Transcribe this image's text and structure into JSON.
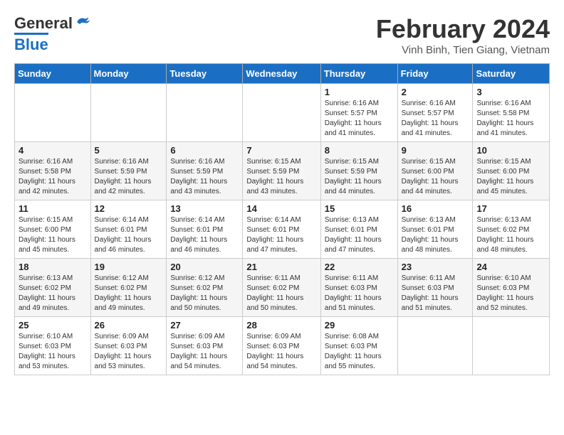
{
  "header": {
    "logo": {
      "line1": "General",
      "line2": "Blue"
    },
    "title": "February 2024",
    "location": "Vinh Binh, Tien Giang, Vietnam"
  },
  "calendar": {
    "days_of_week": [
      "Sunday",
      "Monday",
      "Tuesday",
      "Wednesday",
      "Thursday",
      "Friday",
      "Saturday"
    ],
    "weeks": [
      [
        {
          "day": "",
          "info": ""
        },
        {
          "day": "",
          "info": ""
        },
        {
          "day": "",
          "info": ""
        },
        {
          "day": "",
          "info": ""
        },
        {
          "day": "1",
          "info": "Sunrise: 6:16 AM\nSunset: 5:57 PM\nDaylight: 11 hours and 41 minutes."
        },
        {
          "day": "2",
          "info": "Sunrise: 6:16 AM\nSunset: 5:57 PM\nDaylight: 11 hours and 41 minutes."
        },
        {
          "day": "3",
          "info": "Sunrise: 6:16 AM\nSunset: 5:58 PM\nDaylight: 11 hours and 41 minutes."
        }
      ],
      [
        {
          "day": "4",
          "info": "Sunrise: 6:16 AM\nSunset: 5:58 PM\nDaylight: 11 hours and 42 minutes."
        },
        {
          "day": "5",
          "info": "Sunrise: 6:16 AM\nSunset: 5:59 PM\nDaylight: 11 hours and 42 minutes."
        },
        {
          "day": "6",
          "info": "Sunrise: 6:16 AM\nSunset: 5:59 PM\nDaylight: 11 hours and 43 minutes."
        },
        {
          "day": "7",
          "info": "Sunrise: 6:15 AM\nSunset: 5:59 PM\nDaylight: 11 hours and 43 minutes."
        },
        {
          "day": "8",
          "info": "Sunrise: 6:15 AM\nSunset: 5:59 PM\nDaylight: 11 hours and 44 minutes."
        },
        {
          "day": "9",
          "info": "Sunrise: 6:15 AM\nSunset: 6:00 PM\nDaylight: 11 hours and 44 minutes."
        },
        {
          "day": "10",
          "info": "Sunrise: 6:15 AM\nSunset: 6:00 PM\nDaylight: 11 hours and 45 minutes."
        }
      ],
      [
        {
          "day": "11",
          "info": "Sunrise: 6:15 AM\nSunset: 6:00 PM\nDaylight: 11 hours and 45 minutes."
        },
        {
          "day": "12",
          "info": "Sunrise: 6:14 AM\nSunset: 6:01 PM\nDaylight: 11 hours and 46 minutes."
        },
        {
          "day": "13",
          "info": "Sunrise: 6:14 AM\nSunset: 6:01 PM\nDaylight: 11 hours and 46 minutes."
        },
        {
          "day": "14",
          "info": "Sunrise: 6:14 AM\nSunset: 6:01 PM\nDaylight: 11 hours and 47 minutes."
        },
        {
          "day": "15",
          "info": "Sunrise: 6:13 AM\nSunset: 6:01 PM\nDaylight: 11 hours and 47 minutes."
        },
        {
          "day": "16",
          "info": "Sunrise: 6:13 AM\nSunset: 6:01 PM\nDaylight: 11 hours and 48 minutes."
        },
        {
          "day": "17",
          "info": "Sunrise: 6:13 AM\nSunset: 6:02 PM\nDaylight: 11 hours and 48 minutes."
        }
      ],
      [
        {
          "day": "18",
          "info": "Sunrise: 6:13 AM\nSunset: 6:02 PM\nDaylight: 11 hours and 49 minutes."
        },
        {
          "day": "19",
          "info": "Sunrise: 6:12 AM\nSunset: 6:02 PM\nDaylight: 11 hours and 49 minutes."
        },
        {
          "day": "20",
          "info": "Sunrise: 6:12 AM\nSunset: 6:02 PM\nDaylight: 11 hours and 50 minutes."
        },
        {
          "day": "21",
          "info": "Sunrise: 6:11 AM\nSunset: 6:02 PM\nDaylight: 11 hours and 50 minutes."
        },
        {
          "day": "22",
          "info": "Sunrise: 6:11 AM\nSunset: 6:03 PM\nDaylight: 11 hours and 51 minutes."
        },
        {
          "day": "23",
          "info": "Sunrise: 6:11 AM\nSunset: 6:03 PM\nDaylight: 11 hours and 51 minutes."
        },
        {
          "day": "24",
          "info": "Sunrise: 6:10 AM\nSunset: 6:03 PM\nDaylight: 11 hours and 52 minutes."
        }
      ],
      [
        {
          "day": "25",
          "info": "Sunrise: 6:10 AM\nSunset: 6:03 PM\nDaylight: 11 hours and 53 minutes."
        },
        {
          "day": "26",
          "info": "Sunrise: 6:09 AM\nSunset: 6:03 PM\nDaylight: 11 hours and 53 minutes."
        },
        {
          "day": "27",
          "info": "Sunrise: 6:09 AM\nSunset: 6:03 PM\nDaylight: 11 hours and 54 minutes."
        },
        {
          "day": "28",
          "info": "Sunrise: 6:09 AM\nSunset: 6:03 PM\nDaylight: 11 hours and 54 minutes."
        },
        {
          "day": "29",
          "info": "Sunrise: 6:08 AM\nSunset: 6:03 PM\nDaylight: 11 hours and 55 minutes."
        },
        {
          "day": "",
          "info": ""
        },
        {
          "day": "",
          "info": ""
        }
      ]
    ]
  }
}
